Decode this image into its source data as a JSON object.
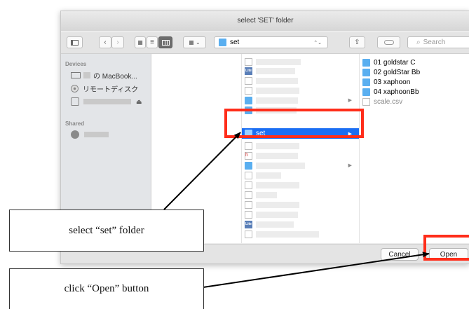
{
  "dialog": {
    "title": "select 'SET' folder",
    "toolbar": {
      "back_icon": "chevron-left-icon",
      "forward_icon": "chevron-right-icon",
      "path_folder": "set",
      "path_chevron": "⌃⌄",
      "search_placeholder": "Search"
    },
    "sidebar": {
      "devices_header": "Devices",
      "macbook_label": "の MacBook...",
      "remote_disc_label": "リモートディスク",
      "eject_glyph": "⏏",
      "shared_header": "Shared"
    },
    "column2": {
      "selected_folder": "set"
    },
    "column3": {
      "items": [
        {
          "label": "01 goldstar C",
          "icon": "folder-icon"
        },
        {
          "label": "02 goldStar Bb",
          "icon": "folder-icon"
        },
        {
          "label": "03 xaphoon",
          "icon": "folder-icon"
        },
        {
          "label": "04 xaphoonBb",
          "icon": "folder-icon"
        },
        {
          "label": "scale.csv",
          "icon": "document-icon"
        }
      ]
    },
    "footer": {
      "cancel_label": "Cancel",
      "open_label": "Open"
    }
  },
  "annotations": {
    "select_text": "select “set” folder",
    "open_text": "click “Open” button",
    "highlight_color": "#ff2d1a"
  }
}
